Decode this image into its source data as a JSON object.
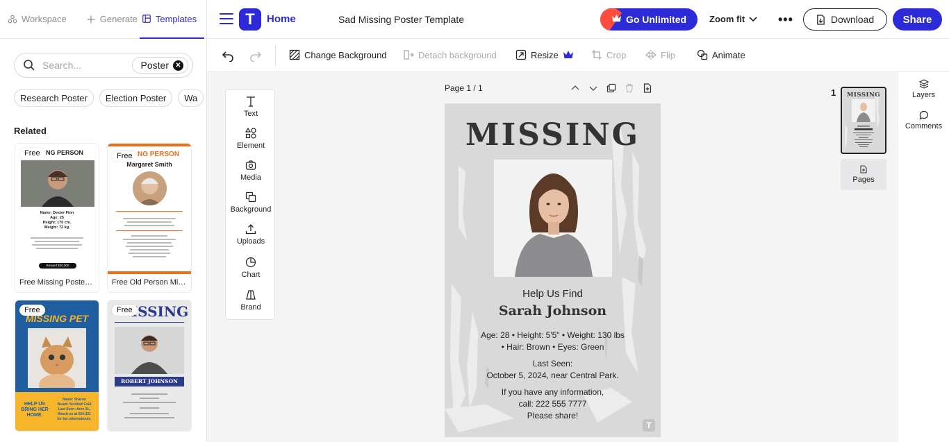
{
  "sidebar": {
    "tabs": [
      {
        "label": "Workspace",
        "icon": "workspace-icon"
      },
      {
        "label": "Generate",
        "icon": "plus-icon"
      },
      {
        "label": "Templates",
        "icon": "templates-icon",
        "active": true
      }
    ],
    "search": {
      "placeholder": "Search...",
      "filter_chip": "Poster"
    },
    "suggestions": [
      "Research Poster",
      "Election Poster",
      "Wa"
    ],
    "related_title": "Related",
    "cards": [
      {
        "badge": "Free",
        "caption": "Free Missing Poster ...",
        "header": "NG PERSON",
        "lines": [
          "Name: Dexter Finn",
          "Age: 25",
          "Height: 170 cm.",
          "Weight: 72 kg."
        ],
        "reward": "Reward $20,000"
      },
      {
        "badge": "Free",
        "caption": "Free Old Person Mis...",
        "header": "NG PERSON",
        "subheader": "Margaret Smith"
      },
      {
        "badge": "Free",
        "header": "MISSING PET",
        "tagline": "HELP US BRING HER HOME.",
        "details": [
          "Name: Sharon",
          "Breed: Scottish Fold",
          "Last Seen: Acre St.,",
          "Reach us at 564-321",
          "for her whereabouts."
        ]
      },
      {
        "badge": "Free",
        "header": "ISSING",
        "nameplate": "ROBERT JOHNSON"
      }
    ]
  },
  "topbar": {
    "home": "Home",
    "doc_title": "Sad Missing Poster Template",
    "go_unlimited": "Go Unlimited",
    "zoom": "Zoom fit",
    "more": "•••",
    "download": "Download",
    "share": "Share",
    "logo_letter": "T"
  },
  "toolbar": {
    "change_background": "Change Background",
    "detach_background": "Detach background",
    "resize": "Resize",
    "crop": "Crop",
    "flip": "Flip",
    "animate": "Animate"
  },
  "tools": [
    "Text",
    "Element",
    "Media",
    "Background",
    "Uploads",
    "Chart",
    "Brand"
  ],
  "canvas": {
    "page_label": "Page 1 / 1",
    "page_number": "1",
    "pages_button": "Pages"
  },
  "poster": {
    "title": "MISSING",
    "help": "Help Us Find",
    "name": "Sarah Johnson",
    "stats_line1": "Age: 28 • Height: 5'5\" • Weight: 130 lbs",
    "stats_line2": "• Hair: Brown • Eyes: Green",
    "last_seen_label": "Last Seen:",
    "last_seen_value": "October 5, 2024, near Central Park.",
    "contact_line1": "If you have any information,",
    "contact_line2": "call: 222 555 7777",
    "contact_line3": "Please share!",
    "watermark_letter": "T"
  },
  "rail": {
    "layers": "Layers",
    "comments": "Comments"
  },
  "colors": {
    "accent": "#2d2bd8",
    "promo_stripe": "#ff4d3d",
    "poster_bg": "#d9d9d9"
  }
}
